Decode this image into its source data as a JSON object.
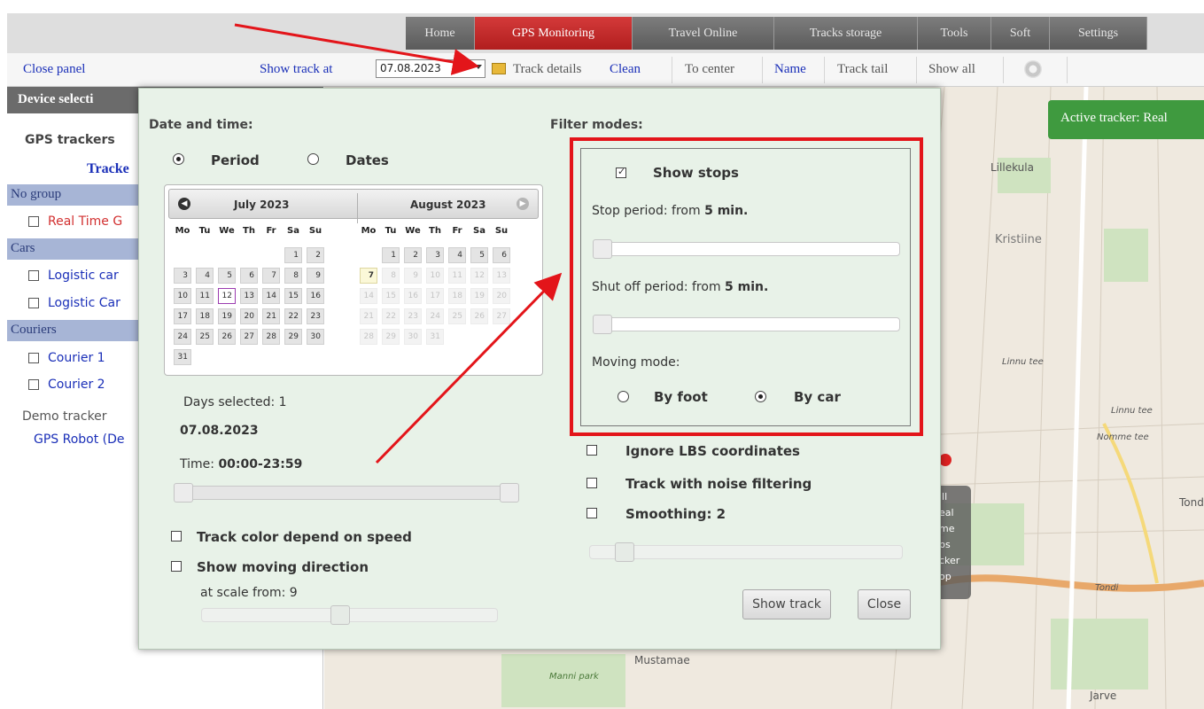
{
  "nav": {
    "tabs": [
      "Home",
      "GPS Monitoring",
      "Travel Online",
      "Tracks storage",
      "Tools",
      "Soft",
      "Settings"
    ],
    "active": "GPS Monitoring"
  },
  "toolbar": {
    "close_panel": "Close panel",
    "show_track_at": "Show track at",
    "date": "07.08.2023",
    "track_details": "Track details",
    "clean": "Clean",
    "to_center": "To center",
    "name": "Name",
    "track_tail": "Track tail",
    "show_all": "Show all"
  },
  "left_panel": {
    "header": "Device selecti",
    "gps_trackers": "GPS trackers",
    "trackers_link": "Tracke",
    "groups": [
      {
        "name": "No group",
        "items": [
          "Real Time G"
        ]
      },
      {
        "name": "Cars",
        "items": [
          "Logistic car",
          "Logistic Car"
        ]
      },
      {
        "name": "Couriers",
        "items": [
          "Courier 1",
          "Courier 2"
        ]
      }
    ],
    "demo_tracker": "Demo tracker",
    "demo_item": "GPS Robot (De"
  },
  "map": {
    "active_tracker": "Active tracker: Real",
    "labels": [
      "Lillekula",
      "Kristiine",
      "Linnu tee",
      "Linnu tee",
      "Nomme tee",
      "Tond",
      "Tondi",
      "Mustamae",
      "Manni park",
      "Jarve"
    ],
    "hint_lines": [
      "ill",
      "eal",
      "me",
      "ps",
      "cker",
      "op"
    ]
  },
  "dialog": {
    "date_time_title": "Date and time:",
    "radio_period": "Period",
    "radio_dates": "Dates",
    "calendar": {
      "left_month": "July 2023",
      "right_month": "August 2023",
      "weekdays": [
        "Mo",
        "Tu",
        "We",
        "Th",
        "Fr",
        "Sa",
        "Su"
      ]
    },
    "days_selected": "Days selected: 1",
    "selected_date": "07.08.2023",
    "time_label": "Time:",
    "time_value": "00:00-23:59",
    "track_color": "Track color depend on speed",
    "show_direction": "Show moving direction",
    "at_scale": "at scale from: 9",
    "filter_title": "Filter modes:",
    "show_stops": "Show stops",
    "stop_period_label": "Stop period: from",
    "stop_period_value": "5 min.",
    "shutoff_label": "Shut off period: from",
    "shutoff_value": "5 min.",
    "moving_mode": "Moving mode:",
    "by_foot": "By foot",
    "by_car": "By car",
    "ignore_lbs": "Ignore LBS coordinates",
    "noise_filter": "Track with noise filtering",
    "smoothing": "Smoothing: 2",
    "show_track_btn": "Show track",
    "close_btn": "Close"
  },
  "colors": {
    "nav_active": "#c62828",
    "accent_link": "#1a2fb8",
    "annotation_red": "#e3151a",
    "dialog_bg": "#e8f2e8",
    "tracker_green": "#3f9a3f"
  }
}
